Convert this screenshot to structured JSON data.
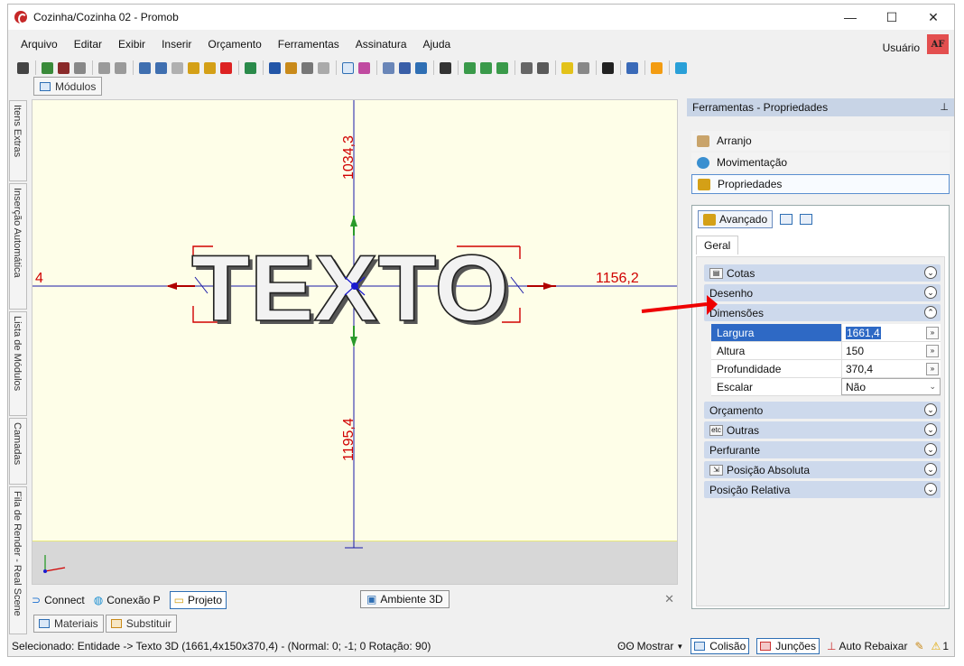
{
  "window": {
    "title": "Cozinha/Cozinha 02 - Promob",
    "controls": [
      "—",
      "☐",
      "✕"
    ]
  },
  "menu": [
    "Arquivo",
    "Editar",
    "Exibir",
    "Inserir",
    "Orçamento",
    "Ferramentas",
    "Assinatura",
    "Ajuda"
  ],
  "user": {
    "label": "Usuário",
    "badge": "AF"
  },
  "modules_tab": "Módulos",
  "left_tabs": [
    "Itens Extras",
    "Inserção Automática",
    "Lista de Módulos",
    "Camadas",
    "Fila de Render - Real Scene"
  ],
  "viewport": {
    "text_object": "TEXTO",
    "dims": {
      "top": "1034,3",
      "bottom": "1195,4",
      "right": "1156,2",
      "left": "4"
    },
    "colors": {
      "background": "#fefee8",
      "dimension": "#d00000",
      "line": "#1a1aa8"
    }
  },
  "bottom_tabs": {
    "connect": "Connect",
    "conexao": "Conexão P",
    "projeto": "Projeto",
    "ambiente": "Ambiente 3D",
    "close": "✕"
  },
  "material_tabs": [
    "Materiais",
    "Substituir"
  ],
  "status": {
    "selection": "Selecionado: Entidade -> Texto 3D (1661,4x150x370,4) - (Normal: 0; -1; 0 Rotação: 90)",
    "mostrar": "Mostrar",
    "colisao": "Colisão",
    "juncoes": "Junções",
    "auto": "Auto Rebaixar",
    "warnings": "1"
  },
  "panel": {
    "title": "Ferramentas - Propriedades",
    "items": [
      "Arranjo",
      "Movimentação",
      "Propriedades"
    ],
    "avancado": "Avançado",
    "tab": "Geral",
    "groups": {
      "cotas": "Cotas",
      "desenho": "Desenho",
      "dimensoes": "Dimensões",
      "orcamento": "Orçamento",
      "outras": "Outras",
      "outras_icon": "etc",
      "perfurante": "Perfurante",
      "posicao_absoluta": "Posição Absoluta",
      "posicao_relativa": "Posição Relativa"
    },
    "rows": [
      {
        "label": "Largura",
        "value": "1661,4"
      },
      {
        "label": "Altura",
        "value": "150"
      },
      {
        "label": "Profundidade",
        "value": "370,4"
      },
      {
        "label": "Escalar",
        "value": "Não"
      }
    ]
  }
}
